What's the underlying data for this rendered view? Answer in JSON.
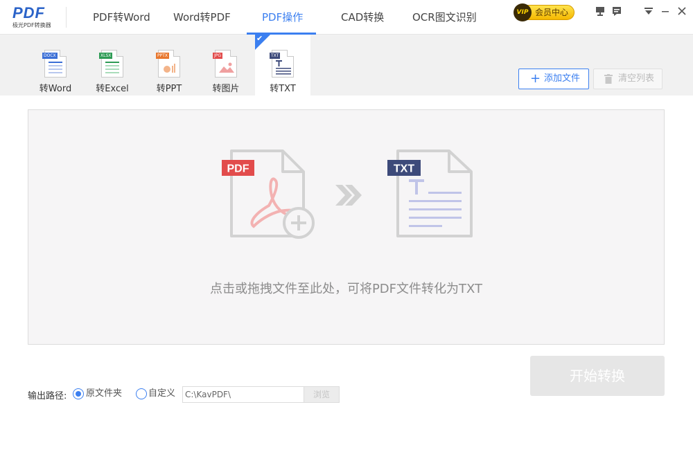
{
  "app": {
    "logo_text": "PDF",
    "logo_sub": "极光PDF转换器"
  },
  "nav": {
    "items": [
      {
        "label": "PDF转Word"
      },
      {
        "label": "Word转PDF"
      },
      {
        "label": "PDF操作",
        "active": true
      },
      {
        "label": "CAD转换"
      },
      {
        "label": "OCR图文识别"
      }
    ],
    "vip_badge": "VIP",
    "vip_label": "会员中心"
  },
  "tools": [
    {
      "label": "转Word",
      "tag": "DOCX",
      "tag_color": "#3b6fd6"
    },
    {
      "label": "转Excel",
      "tag": "XLSX",
      "tag_color": "#2e9b55"
    },
    {
      "label": "转PPT",
      "tag": "PPTX",
      "tag_color": "#e8772e"
    },
    {
      "label": "转图片",
      "tag": "JPG",
      "tag_color": "#e24c4c"
    },
    {
      "label": "转TXT",
      "tag": "TXT",
      "tag_color": "#3d4a7a",
      "active": true
    }
  ],
  "actions": {
    "add_file": "添加文件",
    "clear_list": "清空列表"
  },
  "dropzone": {
    "pdf_tag": "PDF",
    "txt_tag": "TXT",
    "hint": "点击或拖拽文件至此处，可将PDF文件转化为TXT"
  },
  "output": {
    "label": "输出路径:",
    "option_original": "原文件夹",
    "option_custom": "自定义",
    "path_value": "C:\\KavPDF\\",
    "browse": "浏览",
    "start": "开始转换"
  },
  "colors": {
    "accent": "#3b7ff0",
    "pdf_red": "#e24c4c",
    "txt_navy": "#3d4a7a"
  }
}
